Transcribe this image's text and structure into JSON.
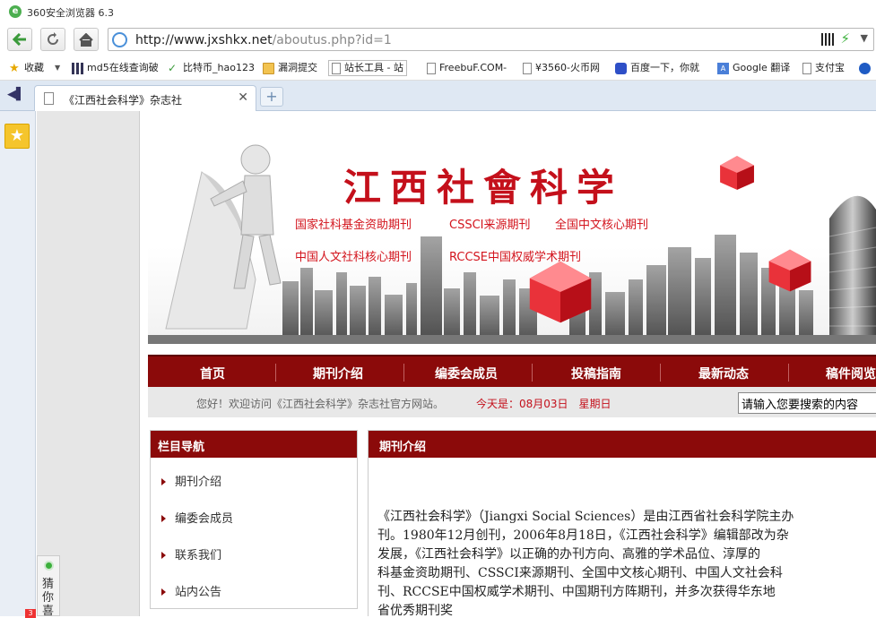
{
  "browser": {
    "app_title": "360安全浏览器 6.3",
    "url_domain": "http://www.jxshkx.net",
    "url_path": "/aboutus.php?id=1",
    "bookmarks": [
      "收藏",
      "md5在线查询破",
      "比特币_hao123",
      "漏洞提交",
      "站长工具 - 站",
      "FreebuF.COM-",
      "¥3560-火币网",
      "百度一下，你就",
      "Google 翻译",
      "支付宝"
    ],
    "tab_title": "《江西社会科学》杂志社",
    "sidebar_guess": "猜你喜"
  },
  "site": {
    "banner_title": "江西社會科学",
    "tags": [
      "国家社科基金资助期刊",
      "CSSCI来源期刊",
      "全国中文核心期刊",
      "中国人文社科核心期刊",
      "RCCSE中国权威学术期刊"
    ],
    "menu": [
      "首页",
      "期刊介绍",
      "编委会成员",
      "投稿指南",
      "最新动态",
      "稿件阅览"
    ],
    "welcome_text": "您好！欢迎访问《江西社会科学》杂志社官方网站。",
    "today_text": "今天是：08月03日　星期日",
    "search_placeholder": "请输入您要搜索的内容",
    "left_nav_title": "栏目导航",
    "left_nav_items": [
      "期刊介绍",
      "编委会成员",
      "联系我们",
      "站内公告"
    ],
    "content_title": "期刊介绍",
    "content_lines": [
      "《江西社会科学》（Jiangxi Social Sciences）是由江西省社会科学院主办",
      "刊。1980年12月创刊，2006年8月18日，《江西社会科学》编辑部改为杂",
      "发展，《江西社会科学》以正确的办刊方向、高雅的学术品位、淳厚的",
      "科基金资助期刊、CSSCI来源期刊、全国中文核心期刊、中国人文社会科",
      "刊、RCCSE中国权威学术期刊、中国期刊方阵期刊，并多次获得华东地",
      "省优秀期刊奖"
    ],
    "brand_red": "#8b0a0a",
    "accent_red": "#c4101b"
  }
}
